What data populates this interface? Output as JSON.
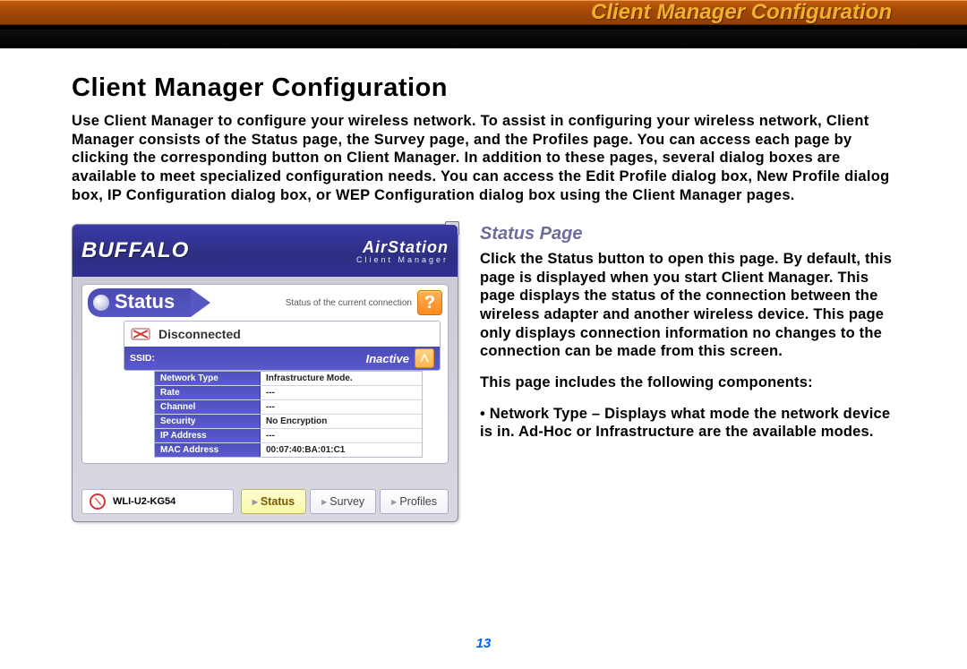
{
  "banner": {
    "title": "Client Manager Configuration"
  },
  "main": {
    "heading": "Client Manager Configuration",
    "intro": "Use Client Manager to configure your wireless network. To assist in configuring your wireless network, Client Manager consists of the Status page, the Survey page, and the Profiles page. You can access each page by clicking the corresponding button on Client Manager. In addition to these pages, several dialog boxes are available to meet specialized configuration needs. You can access the Edit Profile dialog box, New Profile dialog box, IP Configuration dialog box, or WEP Configuration dialog box using the Client Manager pages."
  },
  "dialog": {
    "brand": "BUFFALO",
    "product": "AirStation",
    "product_sub": "Client Manager",
    "close_glyph": "×",
    "status_tab": "Status",
    "conn_caption": "Status of the current connection",
    "help": "?",
    "connection_state": "Disconnected",
    "ssid_label": "SSID:",
    "ssid_state": "Inactive",
    "table": [
      {
        "label": "Network Type",
        "value": "Infrastructure Mode."
      },
      {
        "label": "Rate",
        "value": "---"
      },
      {
        "label": "Channel",
        "value": "---"
      },
      {
        "label": "Security",
        "value": "No Encryption"
      },
      {
        "label": "IP Address",
        "value": "---"
      },
      {
        "label": "MAC Address",
        "value": "00:07:40:BA:01:C1"
      }
    ],
    "adapter": "WLI-U2-KG54",
    "tabs": {
      "status": "Status",
      "survey": "Survey",
      "profiles": "Profiles"
    }
  },
  "side": {
    "subhead": "Status Page",
    "p1_lead": "Click the ",
    "p1_reg1": "Status",
    "p1_tail": " button to open this page. By default, this page is displayed when you start Client Manager. This page displays the status of the connection between the wireless adapter and another wireless device. This page only displays connection information no changes to the connection can be made from this screen.",
    "p2": "This page includes the following components:",
    "b1_lead": "• ",
    "b1_reg": "Network Type",
    "b1_tail": " – Displays what mode the network device is in.  Ad-Hoc or Infrastructure are the available modes."
  },
  "page_number": "13"
}
